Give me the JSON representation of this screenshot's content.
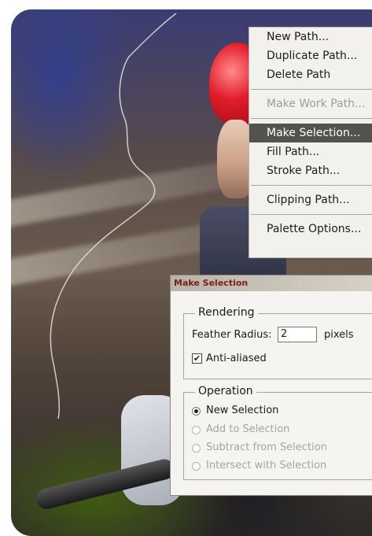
{
  "context_menu": {
    "items": [
      {
        "label": "New Path...",
        "state": "normal"
      },
      {
        "label": "Duplicate Path...",
        "state": "normal"
      },
      {
        "label": "Delete Path",
        "state": "normal"
      },
      {
        "label": "Make Work Path...",
        "state": "disabled"
      },
      {
        "label": "Make Selection...",
        "state": "selected"
      },
      {
        "label": "Fill Path...",
        "state": "normal"
      },
      {
        "label": "Stroke Path...",
        "state": "normal"
      },
      {
        "label": "Clipping Path...",
        "state": "normal"
      },
      {
        "label": "Palette Options...",
        "state": "normal"
      }
    ]
  },
  "dialog": {
    "title": "Make Selection",
    "rendering": {
      "legend": "Rendering",
      "feather_label": "Feather Radius:",
      "feather_value": "2",
      "feather_unit": "pixels",
      "antialiased_label": "Anti-aliased",
      "antialiased_checked": true
    },
    "operation": {
      "legend": "Operation",
      "options": [
        {
          "label": "New Selection",
          "selected": true,
          "enabled": true
        },
        {
          "label": "Add to Selection",
          "selected": false,
          "enabled": false
        },
        {
          "label": "Subtract from Selection",
          "selected": false,
          "enabled": false
        },
        {
          "label": "Intersect with Selection",
          "selected": false,
          "enabled": false
        }
      ]
    }
  },
  "colors": {
    "menu_selected_bg": "#53524f",
    "dialog_title_text": "#7a1e1a",
    "helmet": "#e21c2a"
  },
  "icons": [
    "path-outline",
    "checkmark-icon",
    "radio-button-icon"
  ]
}
